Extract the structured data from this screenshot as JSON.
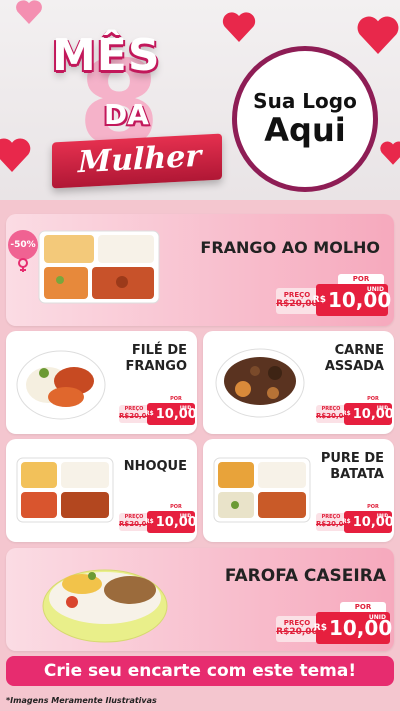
{
  "header": {
    "title_line1": "MÊS",
    "title_line2": "DA",
    "title_big": "8",
    "title_script": "Mulher",
    "logo_line1": "Sua Logo",
    "logo_line2": "Aqui"
  },
  "badge": "-50%",
  "products": [
    {
      "name_lines": [
        "FRANGO AO MOLHO"
      ],
      "por_label": "POR",
      "old_label": "PREÇO",
      "old_price": "R$20,00",
      "currency": "R$",
      "price": "10,00",
      "unit": "UNID"
    },
    {
      "name_lines": [
        "FILÉ DE",
        "FRANGO"
      ],
      "por_label": "POR",
      "old_label": "PREÇO",
      "old_price": "R$20,00",
      "currency": "R$",
      "price": "10,00",
      "unit": "UNID"
    },
    {
      "name_lines": [
        "CARNE",
        "ASSADA"
      ],
      "por_label": "POR",
      "old_label": "PREÇO",
      "old_price": "R$20,00",
      "currency": "R$",
      "price": "10,00",
      "unit": "UNID"
    },
    {
      "name_lines": [
        "NHOQUE"
      ],
      "por_label": "POR",
      "old_label": "PREÇO",
      "old_price": "R$20,00",
      "currency": "R$",
      "price": "10,00",
      "unit": "UNID"
    },
    {
      "name_lines": [
        "PURE DE",
        "BATATA"
      ],
      "por_label": "POR",
      "old_label": "PREÇO",
      "old_price": "R$20,00",
      "currency": "R$",
      "price": "10,00",
      "unit": "UNID"
    },
    {
      "name_lines": [
        "FAROFA CASEIRA"
      ],
      "por_label": "POR",
      "old_label": "PREÇO",
      "old_price": "R$20,00",
      "currency": "R$",
      "price": "10,00",
      "unit": "UNID"
    }
  ],
  "cta": "Crie seu encarte com este tema!",
  "disclaimer": "*Imagens Meramente Ilustrativas",
  "colors": {
    "accent": "#e72c6f",
    "price_red": "#e61f3e",
    "logo_ring": "#8e1d55",
    "background": "#f4c6cf"
  },
  "icons": [
    "heart-icon",
    "female-symbol-icon",
    "tray-meal-icon",
    "bowl-meal-icon"
  ]
}
